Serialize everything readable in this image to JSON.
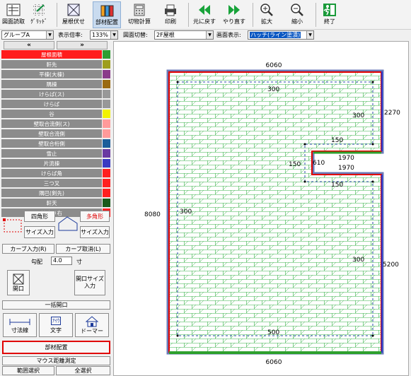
{
  "toolbar": {
    "buttons": [
      {
        "label": "図面読取",
        "icon": "drawing-read-icon"
      },
      {
        "label": "ｸﾞﾘｯﾄﾞ",
        "icon": "grid-icon"
      },
      {
        "label": "屋根伏せ",
        "icon": "roof-plan-icon"
      },
      {
        "label": "部材配置",
        "icon": "member-place-icon"
      },
      {
        "label": "切物計算",
        "icon": "cut-calc-icon"
      },
      {
        "label": "印刷",
        "icon": "print-icon"
      },
      {
        "label": "元に戻す",
        "icon": "undo-icon"
      },
      {
        "label": "やり直す",
        "icon": "redo-icon"
      },
      {
        "label": "拡大",
        "icon": "zoom-in-icon"
      },
      {
        "label": "縮小",
        "icon": "zoom-out-icon"
      },
      {
        "label": "終了",
        "icon": "exit-icon"
      }
    ]
  },
  "options": {
    "group": "グループA",
    "zoom_label": "表示倍率:",
    "zoom": "133%",
    "switch_label": "図面切替:",
    "switch": "2F屋根",
    "display_label": "画面表示:",
    "display": "ハッチ(ライン塗潰)"
  },
  "left": {
    "nav_prev": "«",
    "nav_next": "»",
    "parts": [
      {
        "label": "屋根面積",
        "color": "#2e9e32"
      },
      {
        "label": "軒先",
        "color": "#9e9e1e"
      },
      {
        "label": "平棟(大棟)",
        "color": "#8a3a8a"
      },
      {
        "label": "隅棟",
        "color": "#9a6a10"
      },
      {
        "label": "けらば(ス)",
        "color": "#989898"
      },
      {
        "label": "けらば",
        "color": "#989898"
      },
      {
        "label": "谷",
        "color": "#f2f200"
      },
      {
        "label": "壁取合流側(ス)",
        "color": "#ff9a9a"
      },
      {
        "label": "壁取合流側",
        "color": "#ff9a9a"
      },
      {
        "label": "壁取合桁側",
        "color": "#1c5e9a"
      },
      {
        "label": "雪止",
        "color": "#6a3aa2"
      },
      {
        "label": "片流棟",
        "color": "#3a3ac2"
      },
      {
        "label": "けらば角",
        "color": "#ff2020"
      },
      {
        "label": "三つ叉",
        "color": "#ff2020"
      },
      {
        "label": "隅巴(剣先)",
        "color": "#ff2020"
      },
      {
        "label": "軒天",
        "color": "#1a5a1a"
      },
      {
        "label": "棟止り右",
        "color": "#ff2020"
      }
    ],
    "shape_square": "四角形",
    "shape_poly": "多角形",
    "size_input": "サイズ入力",
    "curve_input": "カーブ入力(R)",
    "curve_cancel": "カーブ取消(L)",
    "pitch_label": "勾配",
    "pitch_value": "4.0",
    "pitch_unit": "寸",
    "opening": "開口",
    "opening_size": "開口サイズ入力",
    "bulk_opening": "一括開口",
    "dimension": "寸法線",
    "text": "文字",
    "dormer": "ドーマー",
    "text_icon_label": "ｱｲｳ",
    "member_place": "部材配置",
    "mouse_measure": "マウス距離測定",
    "range_select": "範囲選択",
    "select_all": "全選択"
  },
  "drawing": {
    "top_width": "6060",
    "bottom_width": "6060",
    "left_height": "8080",
    "right_upper": "2270",
    "right_lower": "5200",
    "notch_width_top": "1970",
    "notch_width_bottom": "1970",
    "notch_height": "610",
    "margin_top": "300",
    "margin_right_upper": "300",
    "margin_left": "300",
    "margin_right_lower": "300",
    "margin_bottom": "500",
    "notch_offset_top": "150",
    "notch_offset_left": "150",
    "notch_offset_bottom": "150",
    "colors": {
      "outline": "#e00000",
      "eave": "#2ea02e",
      "hatch": "#39b24a",
      "slate": "#6a7ab8"
    }
  }
}
